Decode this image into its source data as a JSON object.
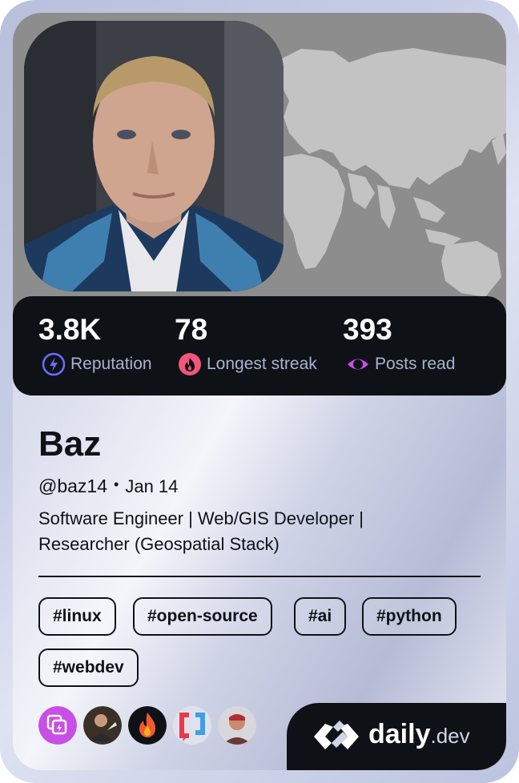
{
  "profile": {
    "name": "Baz",
    "handle": "@baz14",
    "separator": "•",
    "joined": "Jan 14",
    "bio": "Software Engineer | Web/GIS Developer | Researcher (Geospatial Stack)"
  },
  "stats": [
    {
      "value": "3.8K",
      "label": "Reputation",
      "icon": "reputation-bolt-icon",
      "color": "#6b6cf8"
    },
    {
      "value": "78",
      "label": "Longest streak",
      "icon": "streak-flame-icon",
      "color": "#f2567a"
    },
    {
      "value": "393",
      "label": "Posts read",
      "icon": "posts-read-eye-icon",
      "color": "#c84fe5"
    }
  ],
  "tags": [
    "#linux",
    "#open-source",
    "#ai",
    "#python",
    "#webdev"
  ],
  "squads": [
    {
      "name": "squad-icon-stack",
      "color": "#c84fe5"
    },
    {
      "name": "squad-avatar-person",
      "color": "#5a4a3a"
    },
    {
      "name": "squad-fire",
      "color": "#f25a2c"
    },
    {
      "name": "squad-quote",
      "color": "#e83a4a"
    },
    {
      "name": "squad-avatar-2",
      "color": "#c04040"
    }
  ],
  "brand": {
    "main": "daily",
    "suffix": ".dev"
  },
  "colors": {
    "dark": "#0e1217",
    "label": "#a8b3cf"
  }
}
